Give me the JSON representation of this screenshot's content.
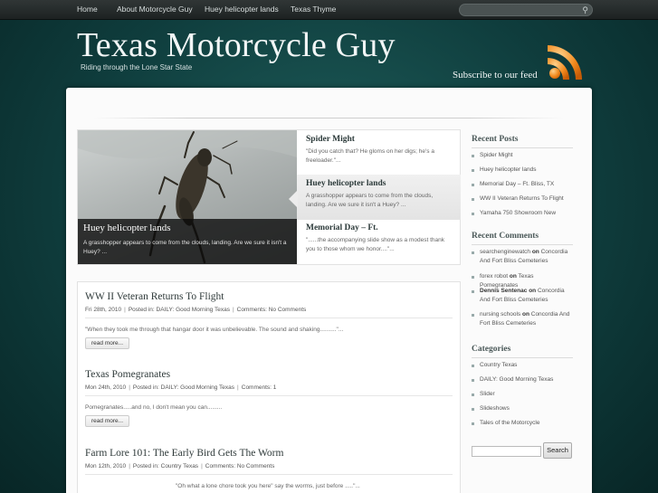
{
  "nav": {
    "items": [
      "Home",
      "About Motorcycle Guy",
      "Huey helicopter lands",
      "Texas Thyme"
    ]
  },
  "header": {
    "title": "Texas Motorcycle Guy",
    "tagline": "Riding through the Lone Star State",
    "subscribe": "Subscribe to our feed"
  },
  "slider": {
    "caption_title": "Huey helicopter lands",
    "caption_text": "A grasshopper appears to come from the clouds, landing. Are we sure it isn't a Huey? ...",
    "items": [
      {
        "title": "Spider Might",
        "text": "\"Did you catch that? He gloms on her digs; he's a freeloader.\"..."
      },
      {
        "title": "Huey helicopter lands",
        "text": "A grasshopper appears to come from the clouds, landing. Are we sure it isn't a Huey? ..."
      },
      {
        "title": "Memorial Day – Ft.",
        "text": "\"......the accompanying slide show as a modest thank you to those whom we honor....\"..."
      }
    ]
  },
  "posts": [
    {
      "title": "WW II Veteran Returns To Flight",
      "date": "Fri 28th, 2010",
      "category_prefix": "Posted in:",
      "category": "DAILY: Good Morning Texas",
      "comments_prefix": "Comments:",
      "comments": "No Comments",
      "excerpt": "\"When they took me through that hangar door it was unbelievable. The sound and shaking..........\"...",
      "read_more": "read more..."
    },
    {
      "title": "Texas Pomegranates",
      "date": "Mon 24th, 2010",
      "category_prefix": "Posted in:",
      "category": "DAILY: Good Morning Texas",
      "comments_prefix": "Comments:",
      "comments": "1",
      "excerpt": "Pomegranates.....and no, I don't mean you can.........",
      "read_more": "read more..."
    },
    {
      "title": "Farm Lore 101: The Early Bird Gets The Worm",
      "date": "Mon 12th, 2010",
      "category_prefix": "Posted in:",
      "category": "Country Texas",
      "comments_prefix": "Comments:",
      "comments": "No Comments",
      "excerpt": "\"Oh what a lone chore took you here\" say the worms, just before .....\"...",
      "read_more": ""
    }
  ],
  "sidebar": {
    "recent_posts_title": "Recent Posts",
    "recent_posts": [
      "Spider Might",
      "Huey helicopter lands",
      "Memorial Day – Ft. Bliss, TX",
      "WW II Veteran Returns To Flight",
      "Yamaha 750 Showroom New"
    ],
    "recent_comments_title": "Recent Comments",
    "recent_comments": [
      {
        "author": "searchenginewatch",
        "on": "on",
        "post": "Concordia And Fort Bliss Cemeteries"
      },
      {
        "author": "forex robot",
        "on": "on",
        "post": "Texas Pomegranates"
      },
      {
        "author": "Dennis Sentenac",
        "on": "on",
        "post": "Concordia And Fort Bliss Cemeteries"
      },
      {
        "author": "nursing schools",
        "on": "on",
        "post": "Concordia And Fort Bliss Cemeteries"
      }
    ],
    "categories_title": "Categories",
    "categories": [
      "Country Texas",
      "DAILY: Good Morning Texas",
      "Slider",
      "Slideshows",
      "Tales of the Motorcycle"
    ],
    "search_button": "Search"
  },
  "colors": {
    "background": "#0f3d3d",
    "nav_bar": "#262c2c",
    "rss_orange": "#f28a1e"
  }
}
